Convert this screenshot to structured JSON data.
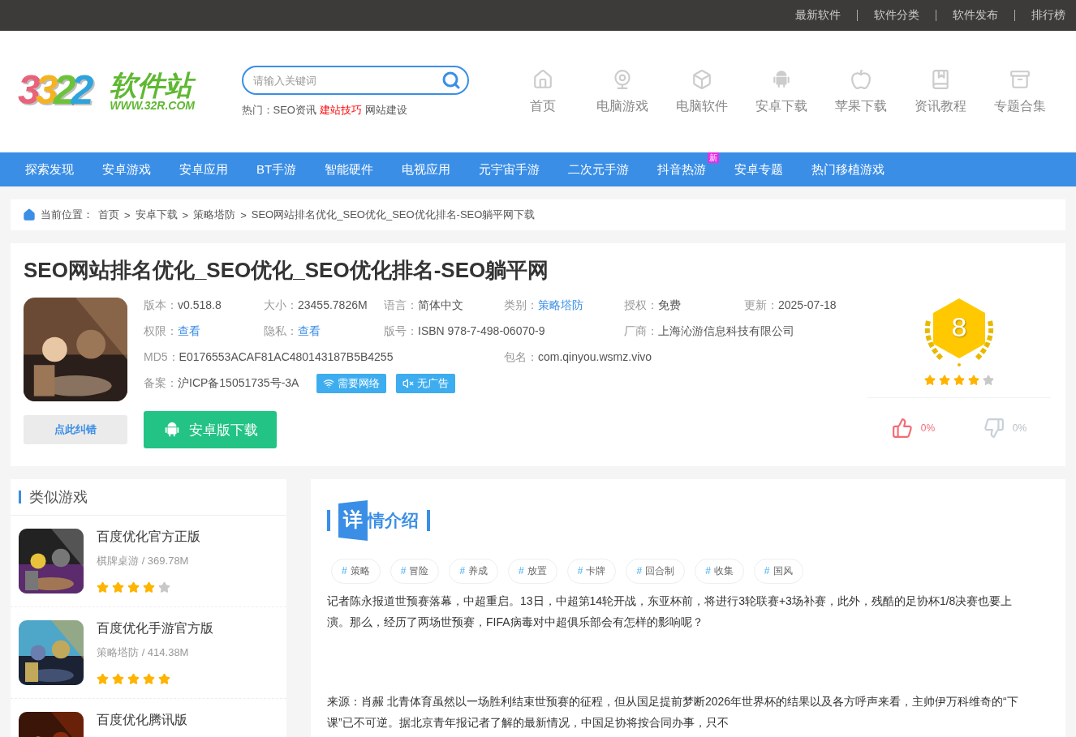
{
  "top_links": [
    "最新软件",
    "软件分类",
    "软件发布",
    "排行榜"
  ],
  "logo": {
    "digits": [
      "3",
      "3",
      "2",
      "2"
    ],
    "name": "软件站",
    "url": "WWW.32R.COM"
  },
  "search": {
    "placeholder": "请输入关键词"
  },
  "hot": {
    "label": "热门：",
    "links": [
      {
        "text": "SEO资讯",
        "highlight": false
      },
      {
        "text": "建站技巧",
        "highlight": true
      },
      {
        "text": "网站建设",
        "highlight": false
      }
    ]
  },
  "nav_icons": [
    {
      "label": "首页",
      "kind": "home"
    },
    {
      "label": "电脑游戏",
      "kind": "webcam"
    },
    {
      "label": "电脑软件",
      "kind": "box"
    },
    {
      "label": "安卓下载",
      "kind": "android"
    },
    {
      "label": "苹果下载",
      "kind": "apple"
    },
    {
      "label": "资讯教程",
      "kind": "book"
    },
    {
      "label": "专题合集",
      "kind": "archive"
    }
  ],
  "main_nav": [
    {
      "label": "探索发现"
    },
    {
      "label": "安卓游戏"
    },
    {
      "label": "安卓应用"
    },
    {
      "label": "BT手游"
    },
    {
      "label": "智能硬件"
    },
    {
      "label": "电视应用"
    },
    {
      "label": "元宇宙手游"
    },
    {
      "label": "二次元手游"
    },
    {
      "label": "抖音热游",
      "badge": "新"
    },
    {
      "label": "安卓专题"
    },
    {
      "label": "热门移植游戏"
    }
  ],
  "breadcrumb": {
    "label": "当前位置：",
    "separator": ">",
    "items": [
      "首页",
      "安卓下载",
      "策略塔防",
      "SEO网站排名优化_SEO优化_SEO优化排名-SEO躺平网下载"
    ]
  },
  "app": {
    "title": "SEO网站排名优化_SEO优化_SEO优化排名-SEO躺平网",
    "info_rows": [
      [
        {
          "label": "版本：",
          "value": "v0.518.8",
          "link": false
        },
        {
          "label": "大小：",
          "value": "23455.7826M",
          "link": false
        },
        {
          "label": "语言：",
          "value": "简体中文",
          "link": false
        },
        {
          "label": "类别：",
          "value": "策略塔防",
          "link": true
        },
        {
          "label": "授权：",
          "value": "免费",
          "link": false
        },
        {
          "label": "更新：",
          "value": "2025-07-18",
          "link": false
        }
      ],
      [
        {
          "label": "权限：",
          "value": "查看",
          "link": true
        },
        {
          "label": "隐私：",
          "value": "查看",
          "link": true
        },
        {
          "label": "版号：",
          "value": "ISBN 978-7-498-06070-9",
          "link": false
        },
        {
          "label": "厂商：",
          "value": "上海沁游信息科技有限公司",
          "link": false
        }
      ],
      [
        {
          "label": "MD5：",
          "value": "E0176553ACAF81AC480143187B5B4255",
          "link": false
        },
        {
          "label": "包名：",
          "value": "com.qinyou.wsmz.vivo",
          "link": false
        }
      ],
      [
        {
          "label": "备案：",
          "value": "沪ICP备15051735号-3A",
          "link": false
        }
      ]
    ],
    "tags": [
      {
        "text": "需要网络",
        "kind": "network"
      },
      {
        "text": "无广告",
        "kind": "no-ads"
      }
    ],
    "report_button": "点此纠错",
    "download_button": "安卓版下载",
    "score": "8",
    "stars": 4,
    "like": "0%",
    "dislike": "0%"
  },
  "similar": {
    "title": "类似游戏",
    "items": [
      {
        "name": "百度优化官方正版",
        "category": "棋牌桌游",
        "size": "/ 369.78M",
        "stars": 4
      },
      {
        "name": "百度优化手游官方版",
        "category": "策略塔防",
        "size": "/ 414.38M",
        "stars": 5
      },
      {
        "name": "百度优化腾讯版"
      }
    ]
  },
  "detail": {
    "title_first": "详",
    "title_rest": "情介绍",
    "tags": [
      "策略",
      "冒险",
      "养成",
      "放置",
      "卡牌",
      "回合制",
      "收集",
      "国风"
    ],
    "tag_mark": "#",
    "paragraphs": [
      "记者陈永报道世预赛落幕，中超重启。13日，中超第14轮开战，东亚杯前，将进行3轮联赛+3场补赛，此外，残酷的足协杯1/8决赛也要上演。那么，经历了两场世预赛，FIFA病毒对中超俱乐部会有怎样的影响呢？",
      "来源：肖赧 北青体育虽然以一场胜利结束世预赛的征程，但从国足提前梦断2026年世界杯的结果以及各方呼声来看，主帅伊万科维奇的“下课”已不可逆。据北京青年报记者了解的最新情况，中国足协将按合同办事，只不"
    ]
  }
}
